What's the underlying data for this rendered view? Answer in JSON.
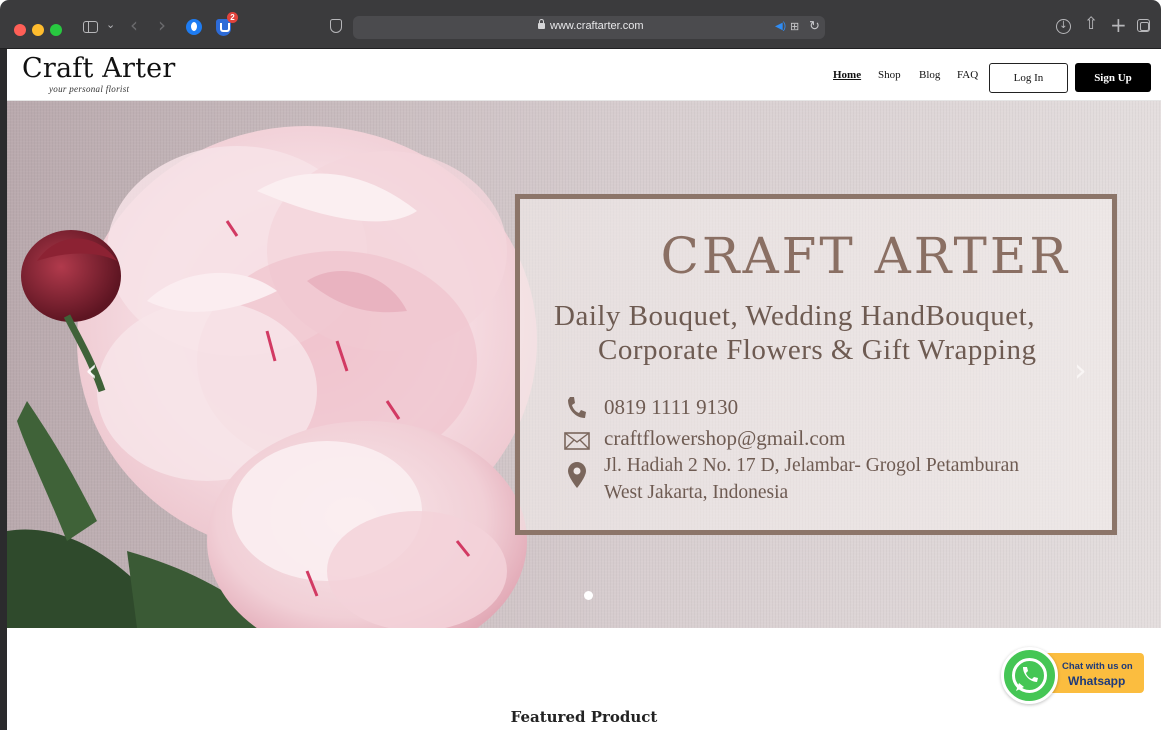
{
  "browser": {
    "url": "www.craftarter.com",
    "extension_badge_count": "2"
  },
  "header": {
    "brand": "Craft Arter",
    "tagline": "your personal florist",
    "nav": [
      {
        "label": "Home",
        "active": true
      },
      {
        "label": "Shop",
        "active": false
      },
      {
        "label": "Blog",
        "active": false
      },
      {
        "label": "FAQ",
        "active": false
      }
    ],
    "login_label": "Log In",
    "signup_label": "Sign Up"
  },
  "hero": {
    "title": "CRAFT ARTER",
    "subtitle_line1": "Daily Bouquet, Wedding HandBouquet,",
    "subtitle_line2": "Corporate Flowers & Gift Wrapping",
    "phone": "0819 1111 9130",
    "email": "craftflowershop@gmail.com",
    "address_line1": "Jl. Hadiah 2 No. 17 D, Jelambar- Grogol Petamburan",
    "address_line2": "West Jakarta, Indonesia",
    "prev_arrow": "‹",
    "next_arrow": "›"
  },
  "whatsapp": {
    "line1": "Chat with us on",
    "line2": "Whatsapp"
  },
  "featured_title": "Featured Product",
  "colors": {
    "accent_text": "#6e5b52",
    "box_border": "#8c7569",
    "whatsapp_green": "#45c655",
    "whatsapp_pill": "#fbbd3f"
  }
}
